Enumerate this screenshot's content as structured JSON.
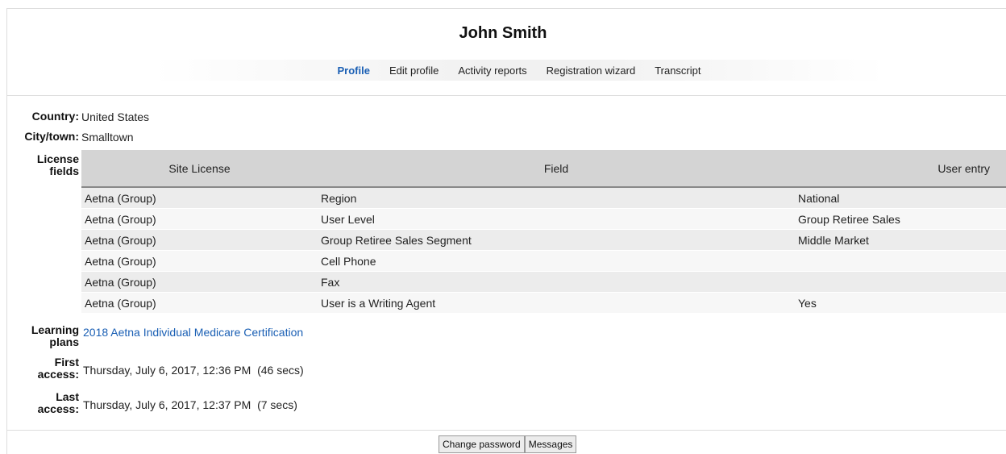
{
  "header": {
    "name": "John Smith"
  },
  "tabs": [
    "Profile",
    "Edit profile",
    "Activity reports",
    "Registration wizard",
    "Transcript"
  ],
  "active_tab": "Profile",
  "fields": {
    "country_label": "Country:",
    "country": "United States",
    "city_label": "City/town:",
    "city": "Smalltown",
    "license_label_1": "License",
    "license_label_2": "fields",
    "learning_label_1": "Learning",
    "learning_label_2": "plans",
    "learning_plan": "2018 Aetna Individual Medicare Certification",
    "first_label_1": "First",
    "first_label_2": "access:",
    "first_access": "Thursday, July 6, 2017, 12:36 PM  (46 secs)",
    "last_label_1": "Last",
    "last_label_2": "access:",
    "last_access": "Thursday, July 6, 2017, 12:37 PM  (7 secs)"
  },
  "license_table": {
    "headers": [
      "Site License",
      "Field",
      "User entry"
    ],
    "rows": [
      [
        "Aetna (Group)",
        "Region",
        "National"
      ],
      [
        "Aetna (Group)",
        "User Level",
        "Group Retiree Sales"
      ],
      [
        "Aetna (Group)",
        "Group Retiree Sales Segment",
        "Middle Market"
      ],
      [
        "Aetna (Group)",
        "Cell Phone",
        ""
      ],
      [
        "Aetna (Group)",
        "Fax",
        ""
      ],
      [
        "Aetna (Group)",
        "User is a Writing Agent",
        "Yes"
      ]
    ]
  },
  "buttons": {
    "change_password": "Change password",
    "messages": "Messages"
  }
}
